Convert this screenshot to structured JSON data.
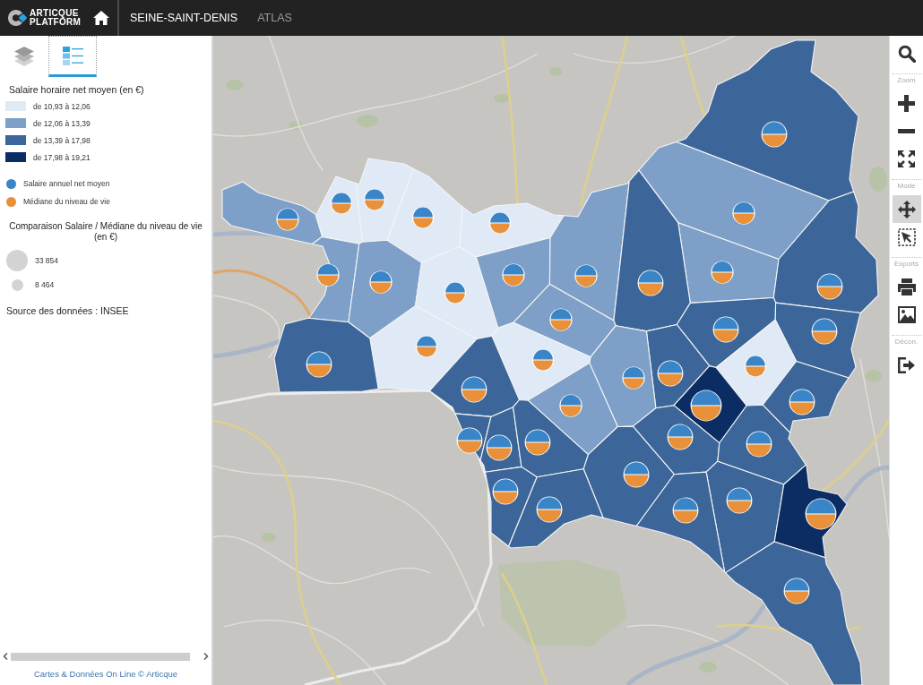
{
  "header": {
    "logo_text": [
      "ARTICQUE",
      "PLATFORM"
    ],
    "nav": [
      {
        "label": "SEINE-SAINT-DENIS",
        "selected": true
      },
      {
        "label": "ATLAS",
        "selected": false
      }
    ]
  },
  "panel_tabs": [
    {
      "kind": "layers",
      "selected": false
    },
    {
      "kind": "legend",
      "selected": true
    }
  ],
  "legend": {
    "title": "Salaire horaire net moyen (en €)",
    "classes": [
      {
        "label": "de 10,93 à 12,06",
        "color": "#dfeaf6"
      },
      {
        "label": "de 12,06 à 13,39",
        "color": "#7ea0c8"
      },
      {
        "label": "de 13,39 à 17,98",
        "color": "#3c6699"
      },
      {
        "label": "de 17,98 à 19,21",
        "color": "#0b2d63"
      }
    ],
    "symbols": [
      {
        "label": "Salaire annuel net moyen",
        "color": "#3a85c8"
      },
      {
        "label": "Médiane du niveau de vie",
        "color": "#e8913a"
      }
    ],
    "size_title": "Comparaison Salaire / Médiane du niveau de vie (en €)",
    "sizes": [
      {
        "kind": "large",
        "label": "33 854"
      },
      {
        "kind": "small",
        "label": "8 464"
      }
    ],
    "source": "Source des données : INSEE"
  },
  "footer": {
    "credit": "Cartes & Données On Line © Articque"
  },
  "map": {
    "communes": [
      {
        "color": "#3c6699"
      },
      {
        "color": "#dfeaf6"
      },
      {
        "color": "#dfeaf6"
      },
      {
        "color": "#dfeaf6"
      },
      {
        "color": "#7ea0c8"
      },
      {
        "color": "#7ea0c8"
      },
      {
        "color": "#dfeaf6"
      },
      {
        "color": "#7ea0c8"
      },
      {
        "color": "#7ea0c8"
      },
      {
        "color": "#7ea0c8"
      },
      {
        "color": "#7ea0c8"
      },
      {
        "color": "#3c6699"
      },
      {
        "color": "#7ea0c8"
      },
      {
        "color": "#3c6699"
      },
      {
        "color": "#dfeaf6"
      },
      {
        "color": "#7ea0c8"
      },
      {
        "color": "#3c6699"
      },
      {
        "color": "#3c6699"
      },
      {
        "color": "#dfeaf6"
      },
      {
        "color": "#dfeaf6"
      },
      {
        "color": "#3c6699"
      },
      {
        "color": "#dfeaf6"
      },
      {
        "color": "#3c6699"
      },
      {
        "color": "#7ea0c8"
      },
      {
        "color": "#3c6699"
      },
      {
        "color": "#3c6699"
      },
      {
        "color": "#0b2d63"
      },
      {
        "color": "#7ea0c8"
      },
      {
        "color": "#3c6699"
      },
      {
        "color": "#3c6699"
      },
      {
        "color": "#3c6699"
      },
      {
        "color": "#3c6699"
      },
      {
        "color": "#3c6699"
      },
      {
        "color": "#3c6699"
      },
      {
        "color": "#3c6699"
      },
      {
        "color": "#3c6699"
      },
      {
        "color": "#3c6699"
      },
      {
        "color": "#3c6699"
      },
      {
        "color": "#0b2d63"
      },
      {
        "color": "#3c6699"
      }
    ]
  },
  "toolbar": {
    "search": {
      "kind": "search"
    },
    "groups": [
      {
        "label": "Zoom",
        "tools": [
          {
            "kind": "zoom-in"
          },
          {
            "kind": "zoom-out"
          },
          {
            "kind": "fit"
          }
        ]
      },
      {
        "label": "Mode",
        "tools": [
          {
            "kind": "pan",
            "selected": true
          },
          {
            "kind": "select",
            "selected": false
          }
        ]
      },
      {
        "label": "Exports",
        "tools": [
          {
            "kind": "print"
          },
          {
            "kind": "image"
          }
        ]
      },
      {
        "label": "Décon.",
        "tools": [
          {
            "kind": "logout"
          }
        ]
      }
    ]
  }
}
